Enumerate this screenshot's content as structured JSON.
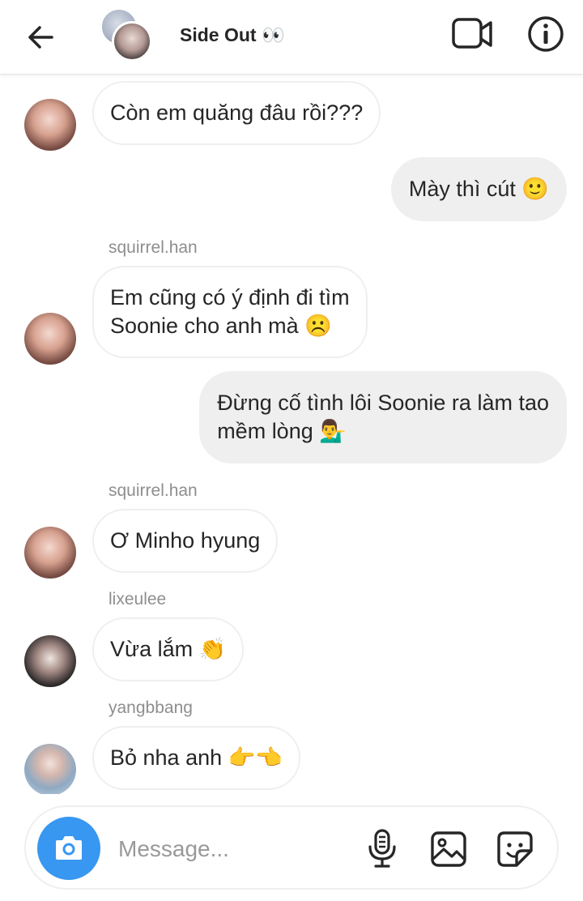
{
  "header": {
    "title": "Side Out 👀",
    "back_icon": "arrow-left-icon",
    "video_icon": "video-call-icon",
    "info_icon": "info-icon"
  },
  "messages": [
    {
      "type": "in",
      "text": "Còn em quăng đâu rồi???"
    },
    {
      "type": "out",
      "text": "Mày thì cút 🙂"
    },
    {
      "sender": "squirrel.han",
      "type": "in",
      "lines": [
        "Em cũng có ý định đi tìm",
        "Soonie cho anh mà ☹️"
      ]
    },
    {
      "type": "out",
      "lines": [
        "Đừng cố tình lôi Soonie ra làm tao",
        "mềm lòng 💁‍♂️"
      ]
    },
    {
      "sender": "squirrel.han",
      "type": "in",
      "text": "Ơ Minho hyung"
    },
    {
      "sender": "lixeulee",
      "type": "in",
      "text": "Vừa lắm 👏"
    },
    {
      "sender": "yangbbang",
      "type": "in",
      "text": "Bỏ nha anh 👉👈"
    }
  ],
  "composer": {
    "placeholder": "Message...",
    "camera_icon": "camera-icon",
    "mic_icon": "microphone-icon",
    "gallery_icon": "image-gallery-icon",
    "sticker_icon": "sticker-icon"
  },
  "colors": {
    "accent": "#3897f0",
    "bubble_out": "#efefef",
    "muted_text": "#8e8e8e"
  }
}
